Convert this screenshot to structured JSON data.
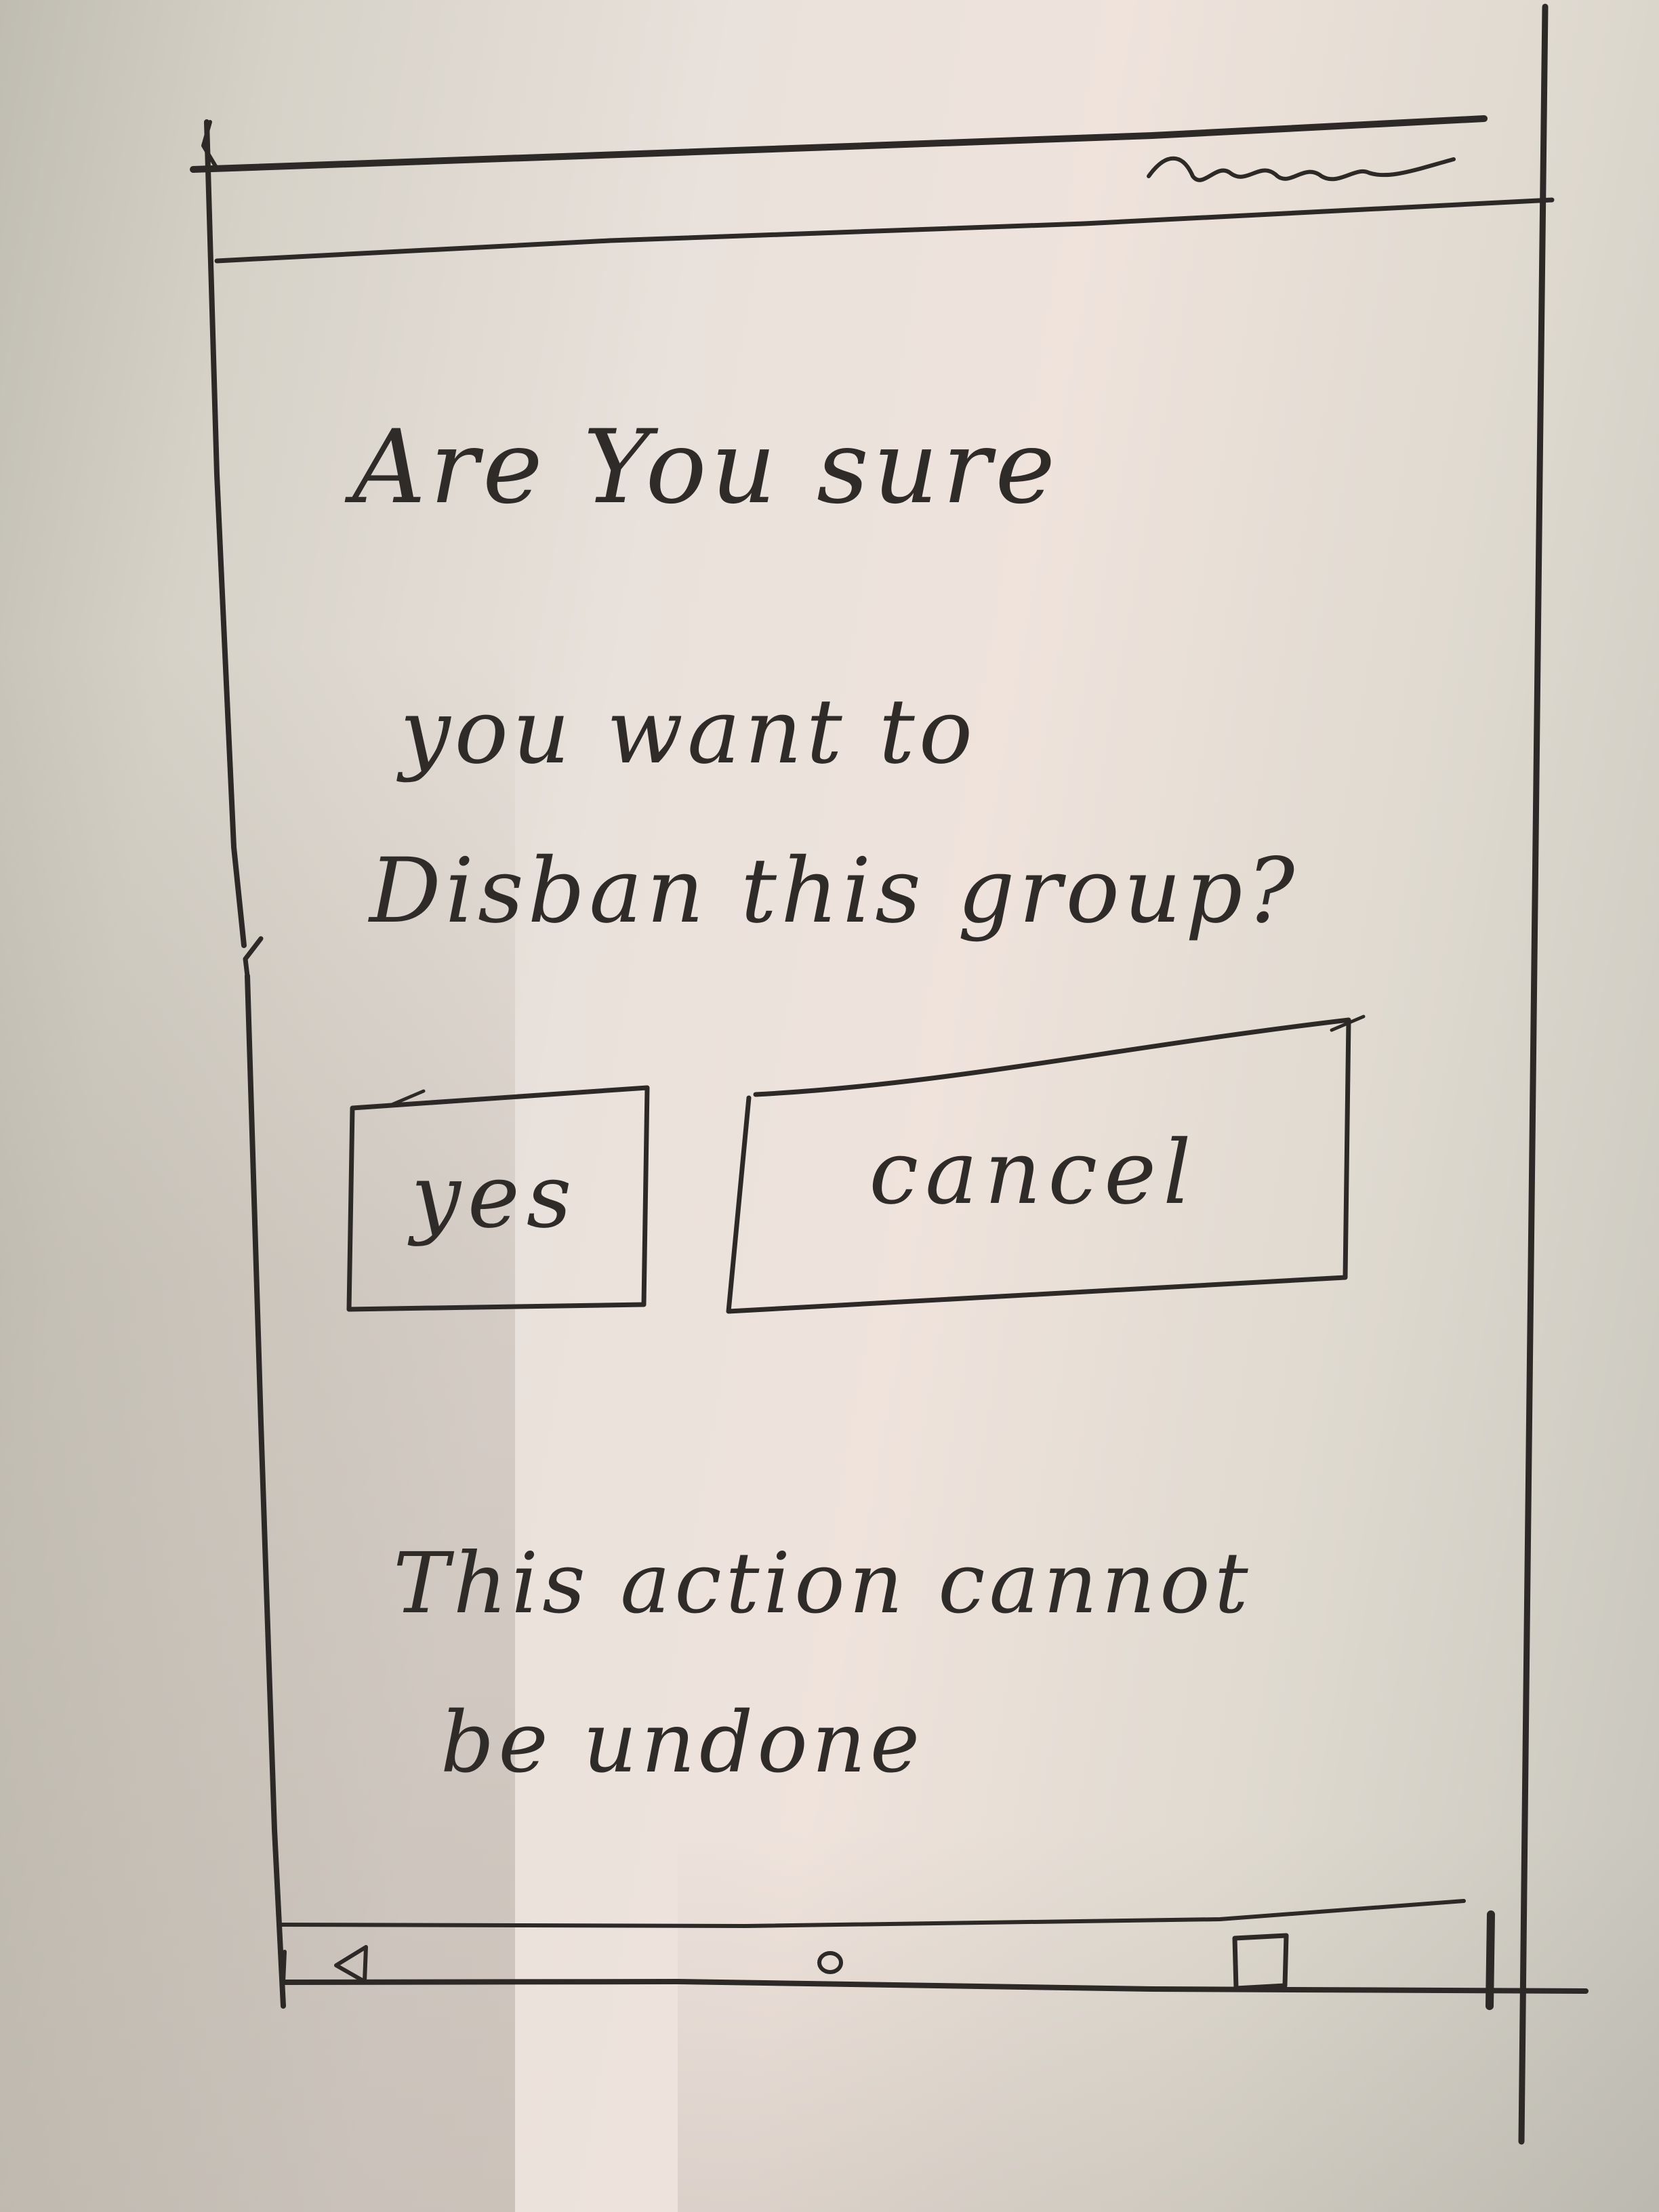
{
  "dialog": {
    "title_line_1": "Are You sure",
    "title_line_2": "you want to",
    "title_line_3": "Disban this group?",
    "yes_label": "yes",
    "cancel_label": "cancel",
    "note_line_1": "This action cannot",
    "note_line_2": "be undone"
  },
  "status_bar": {
    "indicator_icon": "status-squiggle-icon"
  },
  "nav_bar": {
    "back_icon": "back-triangle-icon",
    "home_icon": "home-circle-icon",
    "recents_icon": "recents-square-icon"
  },
  "colors": {
    "pencil": "#2c2926",
    "paper": "#e9e1db"
  }
}
